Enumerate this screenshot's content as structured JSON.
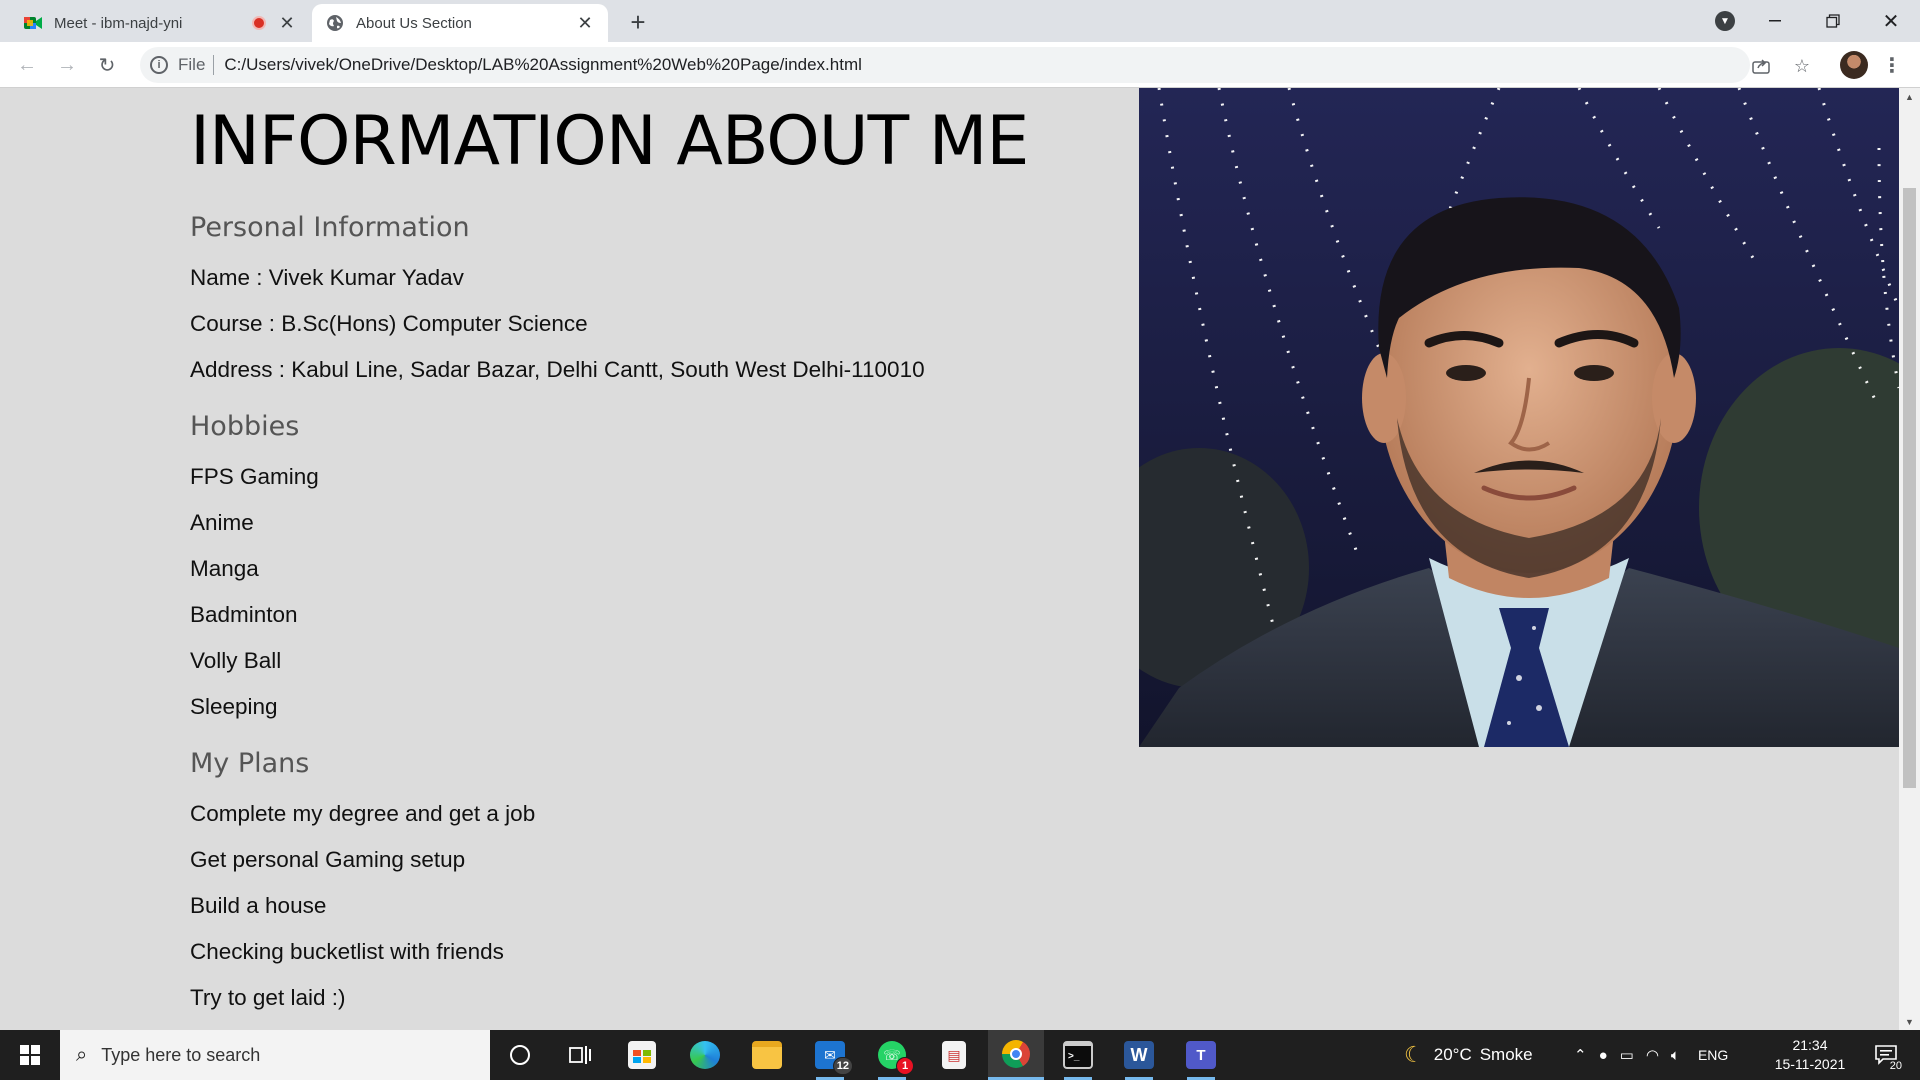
{
  "browser": {
    "tabs": [
      {
        "title": "Meet - ibm-najd-yni",
        "recording": true
      },
      {
        "title": "About Us Section",
        "active": true
      }
    ],
    "new_tab_label": "+",
    "address": {
      "scheme": "File",
      "url": "C:/Users/vivek/OneDrive/Desktop/LAB%20Assignment%20Web%20Page/index.html"
    }
  },
  "page": {
    "title": "INFORMATION ABOUT ME",
    "sections": [
      {
        "heading": "Personal Information",
        "lines": [
          "Name : Vivek Kumar Yadav",
          "Course : B.Sc(Hons) Computer Science",
          "Address : Kabul Line, Sadar Bazar, Delhi Cantt, South West Delhi-110010"
        ]
      },
      {
        "heading": "Hobbies",
        "lines": [
          "FPS Gaming",
          "Anime",
          "Manga",
          "Badminton",
          "Volly Ball",
          "Sleeping"
        ]
      },
      {
        "heading": "My Plans",
        "lines": [
          "Complete my degree and get a job",
          "Get personal Gaming setup",
          "Build a house",
          "Checking bucketlist with friends",
          "Try to get laid :)"
        ]
      }
    ]
  },
  "taskbar": {
    "search_placeholder": "Type here to search",
    "apps": [
      {
        "name": "cortana"
      },
      {
        "name": "task-view"
      },
      {
        "name": "microsoft-store"
      },
      {
        "name": "edge"
      },
      {
        "name": "file-explorer"
      },
      {
        "name": "mail",
        "badge": "12"
      },
      {
        "name": "whatsapp",
        "badge": "1"
      },
      {
        "name": "pdf-editor"
      },
      {
        "name": "chrome",
        "active": true
      },
      {
        "name": "terminal"
      },
      {
        "name": "word",
        "label": "W"
      },
      {
        "name": "teams"
      }
    ],
    "weather": {
      "temp": "20°C",
      "condition": "Smoke"
    },
    "language": "ENG",
    "time": "21:34",
    "date": "15-11-2021",
    "notification_count": "20"
  },
  "colors": {
    "page_background": "#dcdcdc",
    "heading_gray": "#555555",
    "taskbar": "#1f1f1f",
    "accent": "#76b9ed"
  }
}
